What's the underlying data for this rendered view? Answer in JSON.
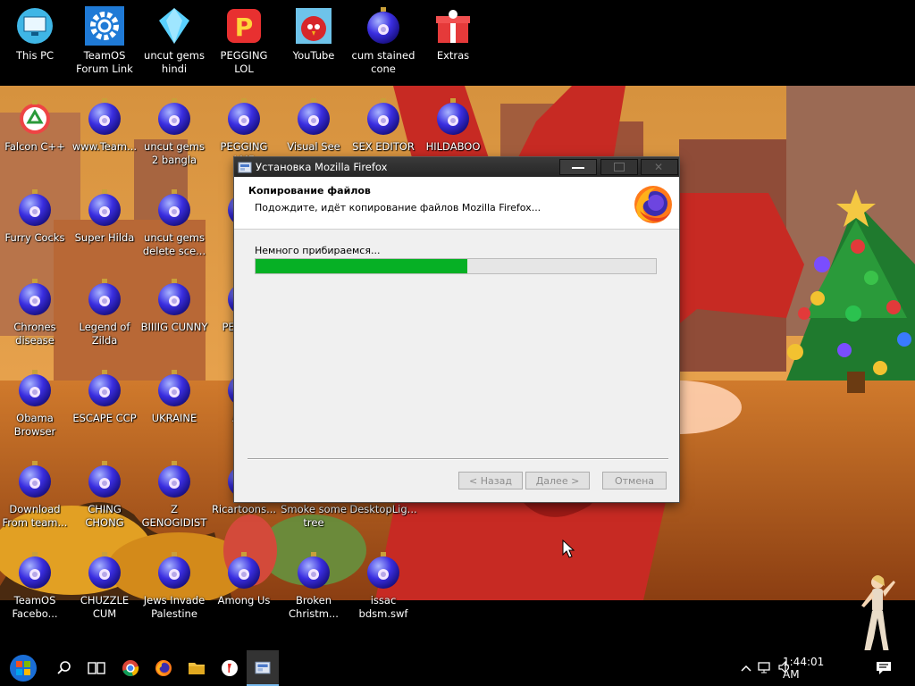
{
  "desktop": {
    "icons": [
      {
        "label": "This PC"
      },
      {
        "label": "TeamOS Forum Link"
      },
      {
        "label": "uncut gems hindi"
      },
      {
        "label": "PEGGING LOL"
      },
      {
        "label": "YouTube"
      },
      {
        "label": "cum stained cone"
      },
      {
        "label": "Extras"
      },
      {
        "label": "Falcon C++"
      },
      {
        "label": "www.Team..."
      },
      {
        "label": "uncut gems 2 bangla"
      },
      {
        "label": "PEGGING LMF"
      },
      {
        "label": "Visual See"
      },
      {
        "label": "SEX EDITOR"
      },
      {
        "label": "HILDABOO"
      },
      {
        "label": "Furry Cocks"
      },
      {
        "label": "Super Hilda"
      },
      {
        "label": "uncut gems delete sce..."
      },
      {
        "label": "PEG"
      },
      {
        "label": "Chrones disease"
      },
      {
        "label": "Legend of Zilda"
      },
      {
        "label": "BIIIIG CUNNY"
      },
      {
        "label": "PEG OFF"
      },
      {
        "label": "Obama Browser"
      },
      {
        "label": "ESCAPE CCP"
      },
      {
        "label": "UKRAINE"
      },
      {
        "label": "AB c"
      },
      {
        "label": "Download From team..."
      },
      {
        "label": "CHING CHONG"
      },
      {
        "label": "Z GENOGIDIST"
      },
      {
        "label": "Ricartoons..."
      },
      {
        "label": "Smoke some tree"
      },
      {
        "label": "DesktopLig..."
      },
      {
        "label": "TeamOS Facebo..."
      },
      {
        "label": "CHUZZLE CUM"
      },
      {
        "label": "Jews Invade Palestine"
      },
      {
        "label": "Among Us"
      },
      {
        "label": "Broken Christm..."
      },
      {
        "label": "issac bdsm.swf"
      }
    ]
  },
  "installer": {
    "title": "Установка Mozilla Firefox",
    "heading": "Копирование файлов",
    "subheading": "Подождите, идёт копирование файлов Mozilla Firefox...",
    "status": "Немного прибираемся...",
    "progress": 0.53,
    "back_label": "< Назад",
    "next_label": "Далее >",
    "cancel_label": "Отмена"
  },
  "taskbar": {
    "apps": [
      "start-icon",
      "search-icon",
      "task-view-icon",
      "chrome-icon",
      "firefox-icon",
      "file-explorer-icon",
      "yandex-icon",
      "installer-icon"
    ],
    "clock": "1:44:01 AM"
  },
  "colors": {
    "progress_fill": "#06b025",
    "titlebar": "#2b2b2b",
    "taskbar": "#000000"
  }
}
